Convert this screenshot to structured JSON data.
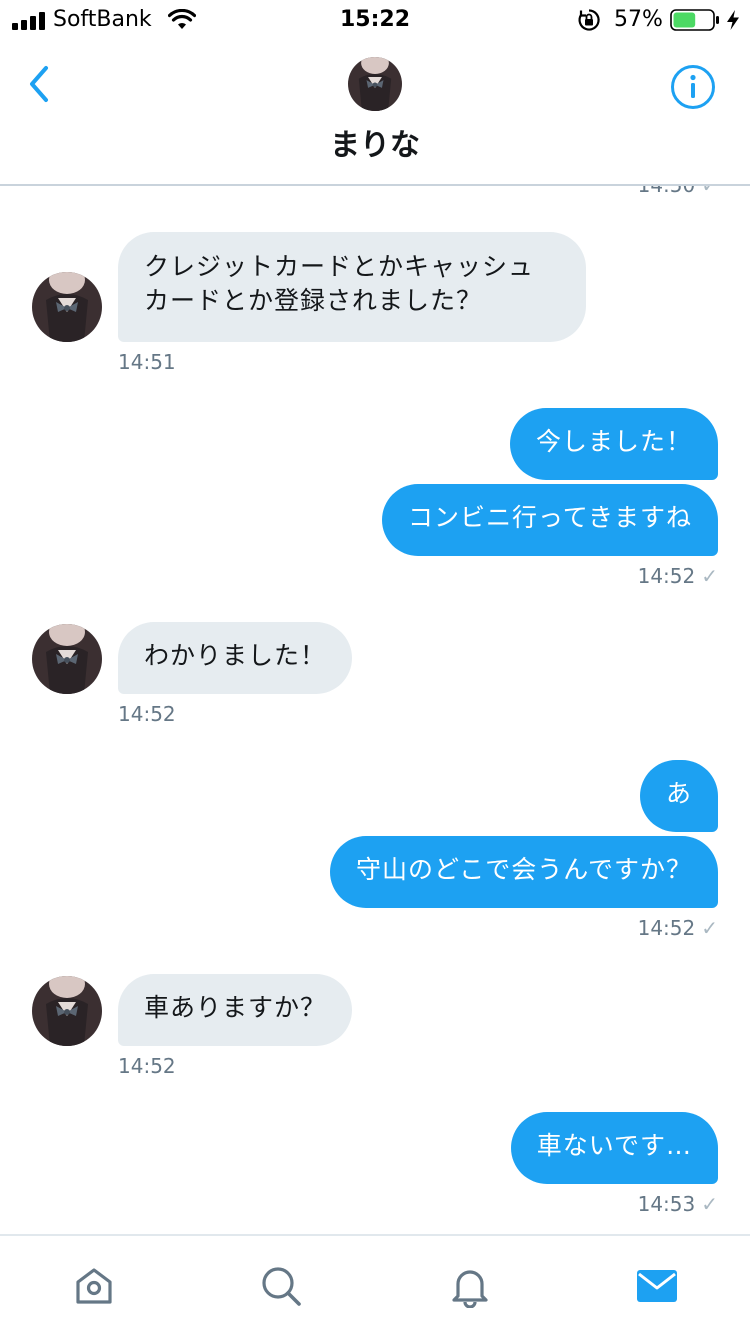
{
  "status_bar": {
    "carrier": "SoftBank",
    "time": "15:22",
    "battery_percent": "57%",
    "battery_level": 0.57,
    "icons": [
      "signal-icon",
      "wifi-icon",
      "orientation-lock-icon",
      "battery-icon",
      "charging-bolt-icon"
    ]
  },
  "header": {
    "title": "まりな",
    "back_icon": "chevron-left-icon",
    "info_icon": "info-icon"
  },
  "conversation": {
    "clipped_top_timestamp": "14:50",
    "messages": [
      {
        "direction": "in",
        "lines": [
          "クレジットカードとかキャッシュ",
          "カードとか登録されました？"
        ],
        "time": "14:51"
      },
      {
        "direction": "out",
        "text": "今しました！"
      },
      {
        "direction": "out",
        "text": "コンビニ行ってきますね",
        "time": "14:52"
      },
      {
        "direction": "in",
        "text": "わかりました！",
        "time": "14:52"
      },
      {
        "direction": "out",
        "text": "あ"
      },
      {
        "direction": "out",
        "text": "守山のどこで会うんですか？",
        "time": "14:52"
      },
      {
        "direction": "in",
        "text": "車ありますか？",
        "time": "14:52"
      },
      {
        "direction": "out",
        "text": "車ないです…",
        "time": "14:53"
      }
    ],
    "read_mark": "✓"
  },
  "tab_bar": {
    "tabs": [
      "home-icon",
      "search-icon",
      "notifications-icon",
      "messages-icon"
    ],
    "active": "messages-icon"
  },
  "colors": {
    "accent": "#1da1f2",
    "incoming_bubble": "#e6ecf0",
    "timestamp": "#657786"
  }
}
